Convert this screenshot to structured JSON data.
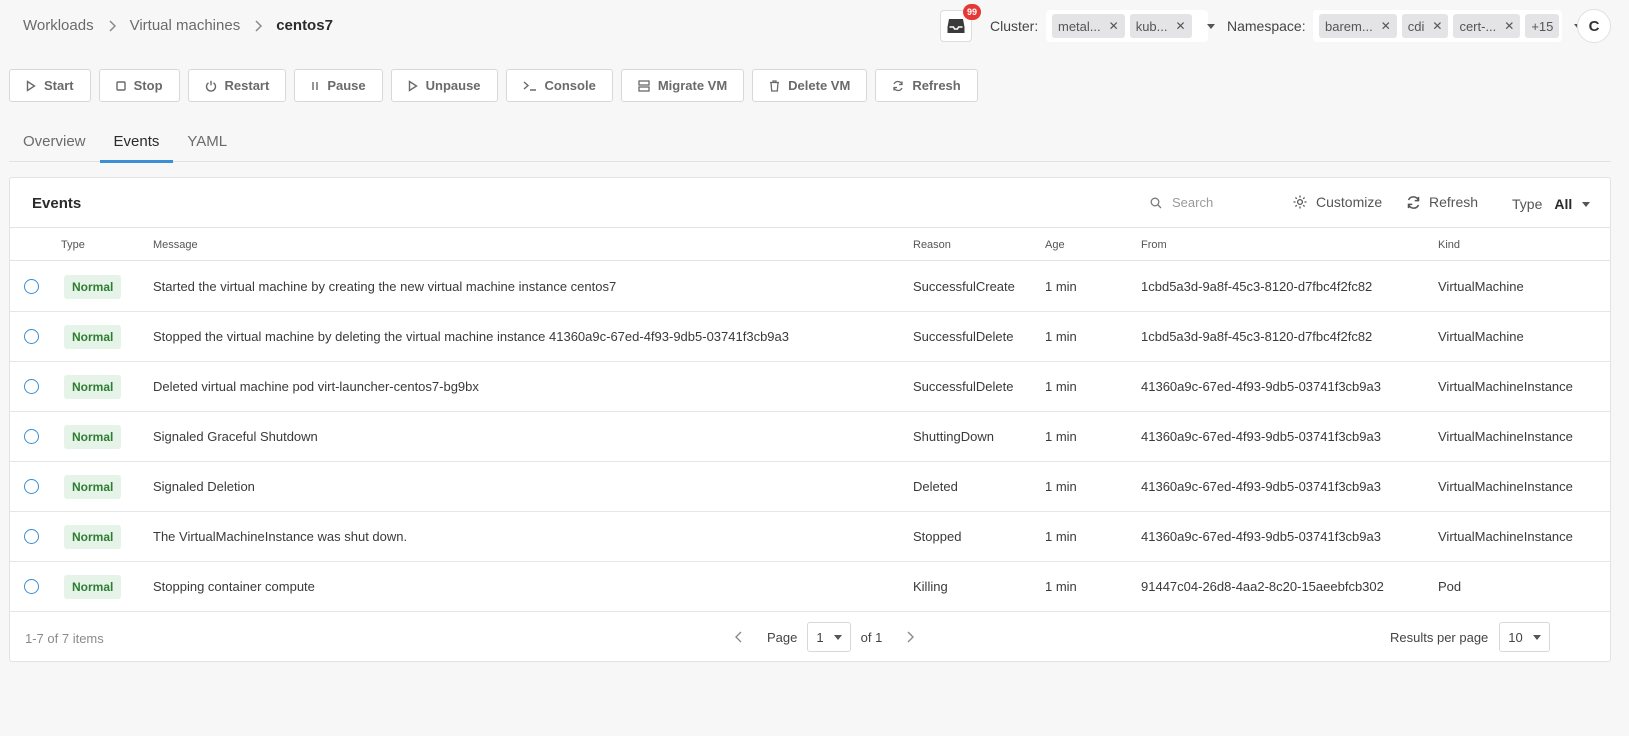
{
  "breadcrumb": {
    "items": [
      "Workloads",
      "Virtual machines"
    ],
    "current": "centos7"
  },
  "notifications": {
    "count": "99"
  },
  "cluster": {
    "label": "Cluster:",
    "chips": [
      "metal...",
      "kub..."
    ]
  },
  "namespace": {
    "label": "Namespace:",
    "chips": [
      "barem...",
      "cdi",
      "cert-..."
    ],
    "more": "+15"
  },
  "user": {
    "initial": "C"
  },
  "actions": [
    "Start",
    "Stop",
    "Restart",
    "Pause",
    "Unpause",
    "Console",
    "Migrate VM",
    "Delete VM",
    "Refresh"
  ],
  "tabs": [
    "Overview",
    "Events",
    "YAML"
  ],
  "events": {
    "title": "Events",
    "search_placeholder": "Search",
    "customize_label": "Customize",
    "refresh_label": "Refresh",
    "type_label": "Type",
    "type_value": "All",
    "columns": [
      "Type",
      "Message",
      "Reason",
      "Age",
      "From",
      "Kind"
    ],
    "rows": [
      {
        "type": "Normal",
        "message": "Started the virtual machine by creating the new virtual machine instance centos7",
        "reason": "SuccessfulCreate",
        "age": "1 min",
        "from": "1cbd5a3d-9a8f-45c3-8120-d7fbc4f2fc82",
        "kind": "VirtualMachine"
      },
      {
        "type": "Normal",
        "message": "Stopped the virtual machine by deleting the virtual machine instance 41360a9c-67ed-4f93-9db5-03741f3cb9a3",
        "reason": "SuccessfulDelete",
        "age": "1 min",
        "from": "1cbd5a3d-9a8f-45c3-8120-d7fbc4f2fc82",
        "kind": "VirtualMachine"
      },
      {
        "type": "Normal",
        "message": "Deleted virtual machine pod virt-launcher-centos7-bg9bx",
        "reason": "SuccessfulDelete",
        "age": "1 min",
        "from": "41360a9c-67ed-4f93-9db5-03741f3cb9a3",
        "kind": "VirtualMachineInstance"
      },
      {
        "type": "Normal",
        "message": "Signaled Graceful Shutdown",
        "reason": "ShuttingDown",
        "age": "1 min",
        "from": "41360a9c-67ed-4f93-9db5-03741f3cb9a3",
        "kind": "VirtualMachineInstance"
      },
      {
        "type": "Normal",
        "message": "Signaled Deletion",
        "reason": "Deleted",
        "age": "1 min",
        "from": "41360a9c-67ed-4f93-9db5-03741f3cb9a3",
        "kind": "VirtualMachineInstance"
      },
      {
        "type": "Normal",
        "message": "The VirtualMachineInstance was shut down.",
        "reason": "Stopped",
        "age": "1 min",
        "from": "41360a9c-67ed-4f93-9db5-03741f3cb9a3",
        "kind": "VirtualMachineInstance"
      },
      {
        "type": "Normal",
        "message": "Stopping container compute",
        "reason": "Killing",
        "age": "1 min",
        "from": "91447c04-26d8-4aa2-8c20-15aeebfcb302",
        "kind": "Pod"
      }
    ],
    "footer": {
      "items_count": "1-7 of 7 items",
      "page_label": "Page",
      "page_value": "1",
      "of_label": "of 1",
      "rpp_label": "Results per page",
      "rpp_value": "10"
    }
  }
}
